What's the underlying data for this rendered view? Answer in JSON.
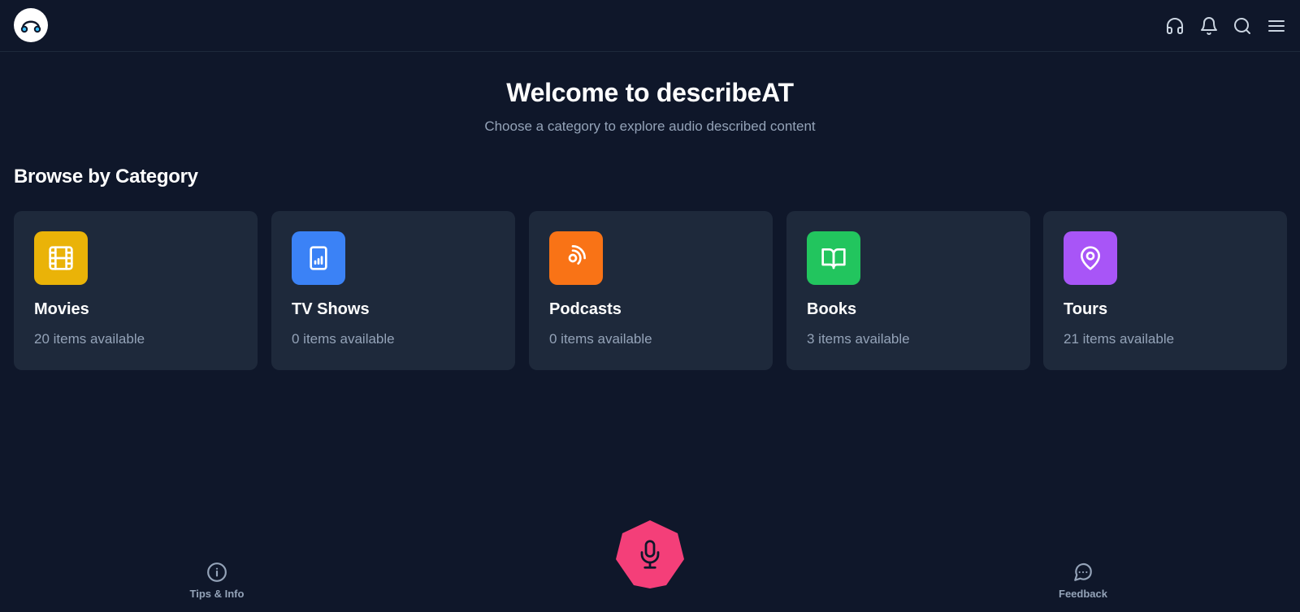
{
  "header": {
    "logo_icon": "headphones-logo-icon",
    "icons": [
      "headphones-icon",
      "bell-icon",
      "search-icon",
      "menu-icon"
    ]
  },
  "hero": {
    "title": "Welcome to describeAT",
    "subtitle": "Choose a category to explore audio described content"
  },
  "section": {
    "title": "Browse by Category"
  },
  "categories": [
    {
      "title": "Movies",
      "count_text": "20 items available",
      "color": "#eab308",
      "icon": "film-icon"
    },
    {
      "title": "TV Shows",
      "count_text": "0 items available",
      "color": "#3b82f6",
      "icon": "tv-icon"
    },
    {
      "title": "Podcasts",
      "count_text": "0 items available",
      "color": "#f97316",
      "icon": "podcast-icon"
    },
    {
      "title": "Books",
      "count_text": "3 items available",
      "color": "#22c55e",
      "icon": "book-open-icon"
    },
    {
      "title": "Tours",
      "count_text": "21 items available",
      "color": "#a855f7",
      "icon": "map-pin-icon"
    }
  ],
  "bottom_nav": {
    "tips_label": "Tips & Info",
    "feedback_label": "Feedback",
    "mic_color": "#f43f79"
  },
  "colors": {
    "background": "#0f172a",
    "card": "#1e293b",
    "muted_text": "#94a3b8"
  }
}
